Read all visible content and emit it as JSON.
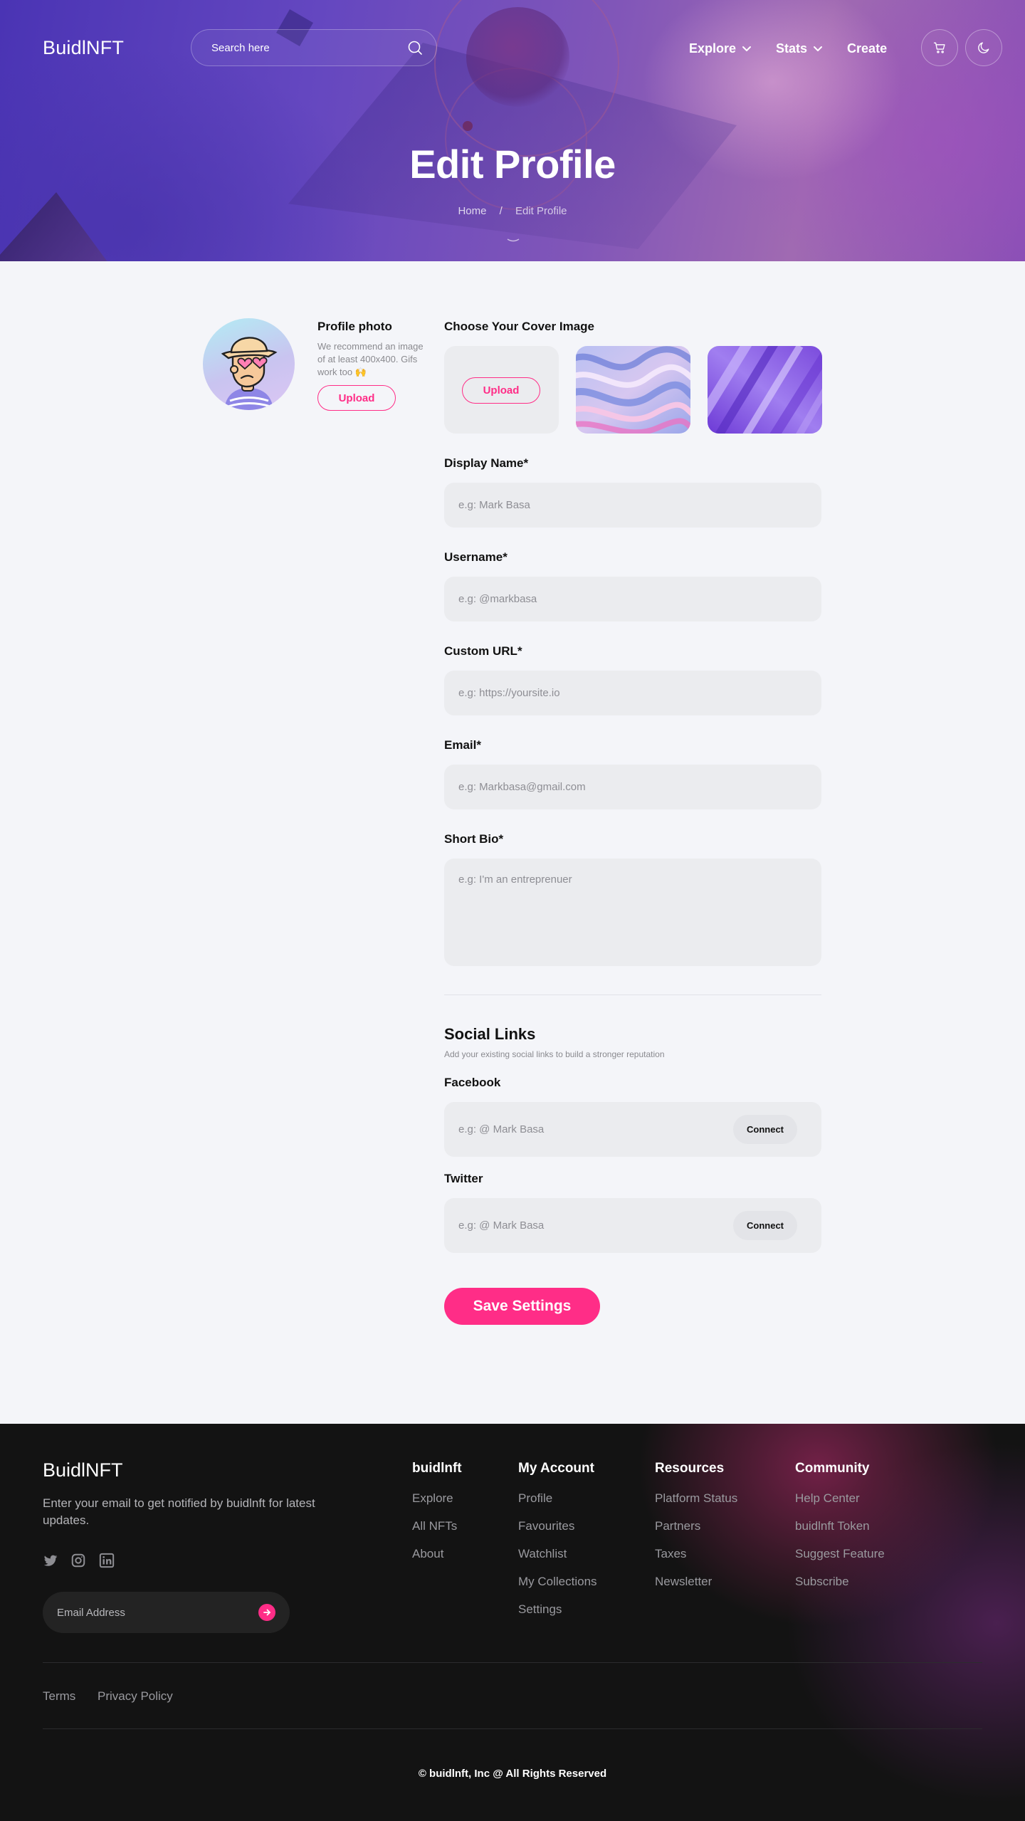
{
  "header": {
    "logo": "BuidlNFT",
    "search_placeholder": "Search here",
    "nav": [
      {
        "label": "Explore",
        "has_dropdown": true
      },
      {
        "label": "Stats",
        "has_dropdown": true
      },
      {
        "label": "Create",
        "has_dropdown": false
      }
    ],
    "icons": {
      "search": "search-icon",
      "cart": "cart-icon",
      "theme": "moon-icon"
    }
  },
  "hero": {
    "title": "Edit Profile",
    "breadcrumb": {
      "home": "Home",
      "separator": "/",
      "current": "Edit Profile"
    }
  },
  "profile_photo": {
    "title": "Profile photo",
    "description": "We recommend an image of at least 400x400. Gifs work too 🙌",
    "upload_label": "Upload"
  },
  "cover": {
    "title": "Choose Your Cover Image",
    "upload_label": "Upload"
  },
  "form": {
    "display_name": {
      "label": "Display Name*",
      "placeholder": "e.g: Mark Basa"
    },
    "username": {
      "label": "Username*",
      "placeholder": "e.g: @markbasa"
    },
    "custom_url": {
      "label": "Custom URL*",
      "placeholder": "e.g: https://yoursite.io"
    },
    "email": {
      "label": "Email*",
      "placeholder": "e.g: Markbasa@gmail.com"
    },
    "bio": {
      "label": "Short Bio*",
      "placeholder": "e.g: I'm an entreprenuer"
    }
  },
  "social": {
    "title": "Social Links",
    "subtitle": "Add your existing social links to build a stronger reputation",
    "facebook": {
      "label": "Facebook",
      "placeholder": "e.g: @ Mark Basa",
      "button": "Connect"
    },
    "twitter": {
      "label": "Twitter",
      "placeholder": "e.g: @ Mark Basa",
      "button": "Connect"
    }
  },
  "save_label": "Save Settings",
  "footer": {
    "logo": "BuidlNFT",
    "description": "Enter your email to get notified by buidlnft for latest updates.",
    "email_placeholder": "Email Address",
    "social_icons": [
      "twitter-icon",
      "instagram-icon",
      "linkedin-icon"
    ],
    "columns": [
      {
        "title": "buidlnft",
        "links": [
          "Explore",
          "All NFTs",
          "About"
        ]
      },
      {
        "title": "My Account",
        "links": [
          "Profile",
          "Favourites",
          "Watchlist",
          "My Collections",
          "Settings"
        ]
      },
      {
        "title": "Resources",
        "links": [
          "Platform Status",
          "Partners",
          "Taxes",
          "Newsletter"
        ]
      },
      {
        "title": "Community",
        "links": [
          "Help Center",
          "buidlnft Token",
          "Suggest Feature",
          "Subscribe"
        ]
      }
    ],
    "legal": {
      "terms": "Terms",
      "privacy": "Privacy Policy"
    },
    "copyright": "© buidlnft, Inc @ All Rights Reserved"
  },
  "colors": {
    "accent": "#ff2d87",
    "page_bg": "#f4f5f9",
    "field_bg": "#ebecef",
    "footer_bg": "#131313"
  }
}
